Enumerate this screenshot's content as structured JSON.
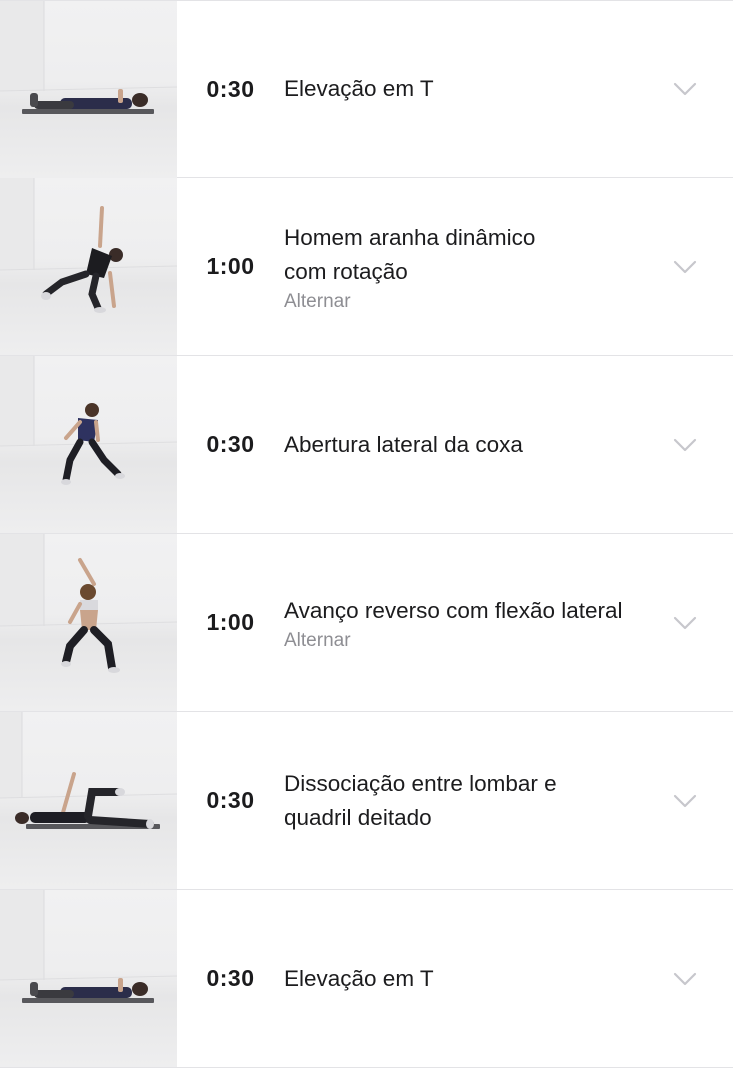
{
  "exercises": [
    {
      "time": "0:30",
      "title": "Elevação em T",
      "subtitle": "",
      "thumbnail": "person-lying-face-down-icon"
    },
    {
      "time": "1:00",
      "title": "Homem aranha dinâmico com rotação",
      "title_lines": [
        "Homem aranha dinâmico",
        "com rotação"
      ],
      "subtitle": "Alternar",
      "thumbnail": "person-lunge-rotation-icon"
    },
    {
      "time": "0:30",
      "title": "Abertura lateral da coxa",
      "subtitle": "",
      "thumbnail": "person-side-lunge-icon"
    },
    {
      "time": "1:00",
      "title": "Avanço reverso com flexão lateral",
      "subtitle": "Alternar",
      "thumbnail": "person-reverse-lunge-icon"
    },
    {
      "time": "0:30",
      "title": "Dissociação entre lombar e quadril deitado",
      "title_lines": [
        "Dissociação entre lombar e",
        "quadril deitado"
      ],
      "subtitle": "",
      "thumbnail": "person-lying-leg-raise-icon"
    },
    {
      "time": "0:30",
      "title": "Elevação em T",
      "subtitle": "",
      "thumbnail": "person-lying-face-down-icon"
    }
  ],
  "colors": {
    "time_text": "#1b1b1d",
    "title_text": "#1c1c1e",
    "subtitle_text": "#8e8e93",
    "chevron": "#c7c7cc",
    "divider": "#e3e3e6"
  },
  "icons": {
    "expand": "chevron-down-icon"
  }
}
